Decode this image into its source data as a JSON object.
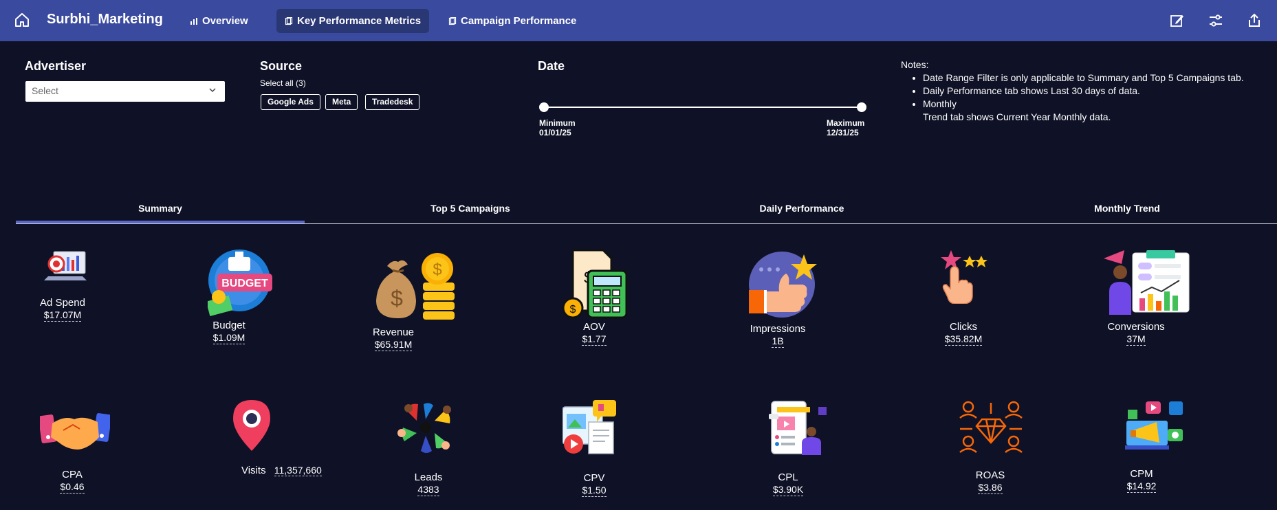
{
  "app": {
    "title": "Surbhi_Marketing"
  },
  "nav": {
    "tabs": [
      {
        "label": "Overview",
        "icon": "bar-chart-icon"
      },
      {
        "label": "Key Performance Metrics",
        "icon": "page-icon",
        "active": true
      },
      {
        "label": "Campaign Performance",
        "icon": "page-icon"
      }
    ],
    "right_icons": [
      "edit-icon",
      "filter-settings-icon",
      "share-icon"
    ]
  },
  "filters": {
    "advertiser": {
      "label": "Advertiser",
      "placeholder": "Select"
    },
    "source": {
      "label": "Source",
      "select_all": "Select all (3)",
      "options": [
        "Google Ads",
        "Meta",
        "Tradedesk"
      ]
    },
    "date": {
      "label": "Date",
      "min_label": "Minimum",
      "min_value": "01/01/25",
      "max_label": "Maximum",
      "max_value": "12/31/25"
    }
  },
  "notes": {
    "title": "Notes:",
    "items": [
      "Date Range Filter is only applicable to Summary and Top 5 Campaigns tab.",
      "Daily Performance tab shows Last 30 days of data.",
      "Monthly",
      "Trend tab shows Current Year Monthly data."
    ]
  },
  "section_tabs": [
    {
      "label": "Summary",
      "active": true
    },
    {
      "label": "Top 5 Campaigns"
    },
    {
      "label": "Daily Performance"
    },
    {
      "label": "Monthly Trend"
    }
  ],
  "kpis": {
    "ad_spend": {
      "label": "Ad Spend",
      "value": "$17.07M"
    },
    "budget": {
      "label": "Budget",
      "value": "$1.09M"
    },
    "revenue": {
      "label": "Revenue",
      "value": "$65.91M"
    },
    "aov": {
      "label": "AOV",
      "value": "$1.77"
    },
    "impressions": {
      "label": "Impressions",
      "value": "1B"
    },
    "clicks": {
      "label": "Clicks",
      "value": "$35.82M"
    },
    "conversions": {
      "label": "Conversions",
      "value": "37M"
    },
    "cpa": {
      "label": "CPA",
      "value": "$0.46"
    },
    "visits": {
      "label": "Visits",
      "value": "11,357,660"
    },
    "leads": {
      "label": "Leads",
      "value": "4383"
    },
    "cpv": {
      "label": "CPV",
      "value": "$1.50"
    },
    "cpl": {
      "label": "CPL",
      "value": "$3.90K"
    },
    "roas": {
      "label": "ROAS",
      "value": "$3.86"
    },
    "cpm": {
      "label": "CPM",
      "value": "$14.92"
    }
  },
  "colors": {
    "topbar": "#3a4a9e",
    "background": "#0f1226",
    "tab_accent": "#5a67c8"
  }
}
